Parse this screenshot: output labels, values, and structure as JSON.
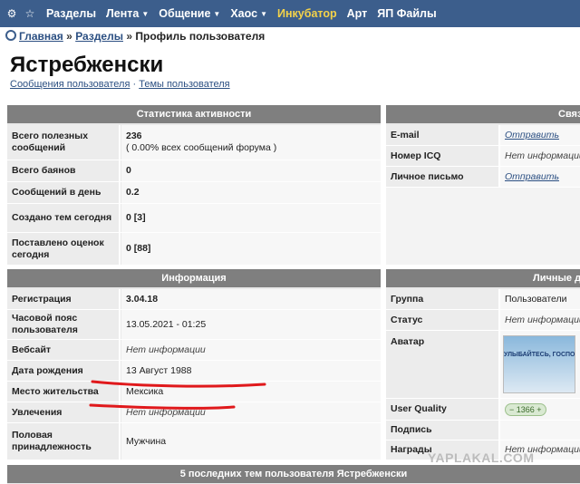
{
  "topbar": {
    "items": [
      {
        "label": "Разделы",
        "caret": ""
      },
      {
        "label": "Лента",
        "caret": "▼"
      },
      {
        "label": "Общение",
        "caret": "▼"
      },
      {
        "label": "Хаос",
        "caret": "▼"
      },
      {
        "label": "Инкубатор",
        "caret": ""
      },
      {
        "label": "Арт",
        "caret": ""
      },
      {
        "label": "ЯП Файлы",
        "caret": ""
      }
    ]
  },
  "breadcrumb": {
    "home": "Главная",
    "sep": "»",
    "sections": "Разделы",
    "current": "Профиль пользователя"
  },
  "profile": {
    "name": "Ястребженски"
  },
  "sublinks": {
    "posts": "Сообщения пользователя",
    "dot": "·",
    "topics": "Темы пользователя"
  },
  "stats": {
    "header": "Статистика активности",
    "rows": [
      {
        "label": "Всего полезных сообщений",
        "value": "236",
        "sub": "( 0.00% всех сообщений форума )"
      },
      {
        "label": "Всего баянов",
        "value": "0"
      },
      {
        "label": "Сообщений в день",
        "value": "0.2"
      },
      {
        "label": "Создано тем сегодня",
        "value": "0 [3]"
      },
      {
        "label": "Поставлено оценок сегодня",
        "value": "0 [88]"
      }
    ]
  },
  "contact": {
    "header": "Связь",
    "rows": [
      {
        "label": "E-mail",
        "value": "Отправить"
      },
      {
        "label": "Номер ICQ",
        "value": "Нет информации"
      },
      {
        "label": "Личное письмо",
        "value": "Отправить"
      }
    ]
  },
  "info": {
    "header": "Информация",
    "rows": [
      {
        "label": "Регистрация",
        "value": "3.04.18"
      },
      {
        "label": "Часовой пояс пользователя",
        "value": "13.05.2021 - 01:25"
      },
      {
        "label": "Вебсайт",
        "value": "Нет информации"
      },
      {
        "label": "Дата рождения",
        "value": "13 Август 1988"
      },
      {
        "label": "Место жительства",
        "value": "Мексика"
      },
      {
        "label": "Увлечения",
        "value": "Нет информации"
      },
      {
        "label": "Половая принадлежность",
        "value": "Мужчина"
      }
    ]
  },
  "personal": {
    "header": "Личные данные",
    "rows": [
      {
        "label": "Группа",
        "value": "Пользователи"
      },
      {
        "label": "Статус",
        "value": "Нет информации"
      },
      {
        "label": "Аватар",
        "value": "УЛЫБАЙТЕСЬ, ГОСПОДА, УЛЫБАЙТЕСЬ"
      },
      {
        "label": "User Quality",
        "value": "1366"
      },
      {
        "label": "Подпись",
        "value": ""
      },
      {
        "label": "Награды",
        "value": "Нет информации"
      }
    ]
  },
  "last_topics": {
    "header": "5 последних тем пользователя Ястребженски"
  },
  "watermark": "YAPLAKAL.COM",
  "colors": {
    "topbar": "#3c5e8c",
    "accent_yellow": "#f3d24a",
    "panel_header": "#7f7f7f",
    "underline_mark": "#e0191c"
  }
}
